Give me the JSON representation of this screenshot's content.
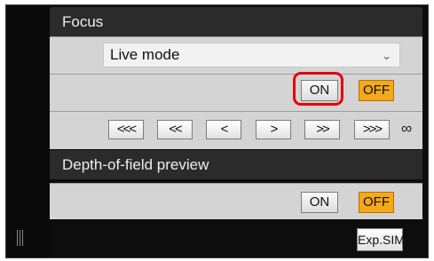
{
  "focus": {
    "title": "Focus",
    "mode_select": {
      "value": "Live mode",
      "icon": "chevron-down-icon"
    },
    "focus_toggle": {
      "on_label": "ON",
      "off_label": "OFF",
      "active": "OFF",
      "on_highlighted": true
    },
    "nav_buttons": [
      "<<<",
      "<<",
      "<",
      ">",
      ">>",
      ">>>"
    ],
    "infinity_label": "∞"
  },
  "dof_preview": {
    "title": "Depth-of-field preview",
    "toggle": {
      "on_label": "ON",
      "off_label": "OFF",
      "active": "OFF"
    }
  },
  "footer": {
    "exp_sim_label": "Exp.SIM"
  },
  "colors": {
    "off_active": "#f4a81a",
    "highlight": "#e6000a",
    "header_bg": "#2b2b2b",
    "row_bg": "#d4d4d4"
  }
}
